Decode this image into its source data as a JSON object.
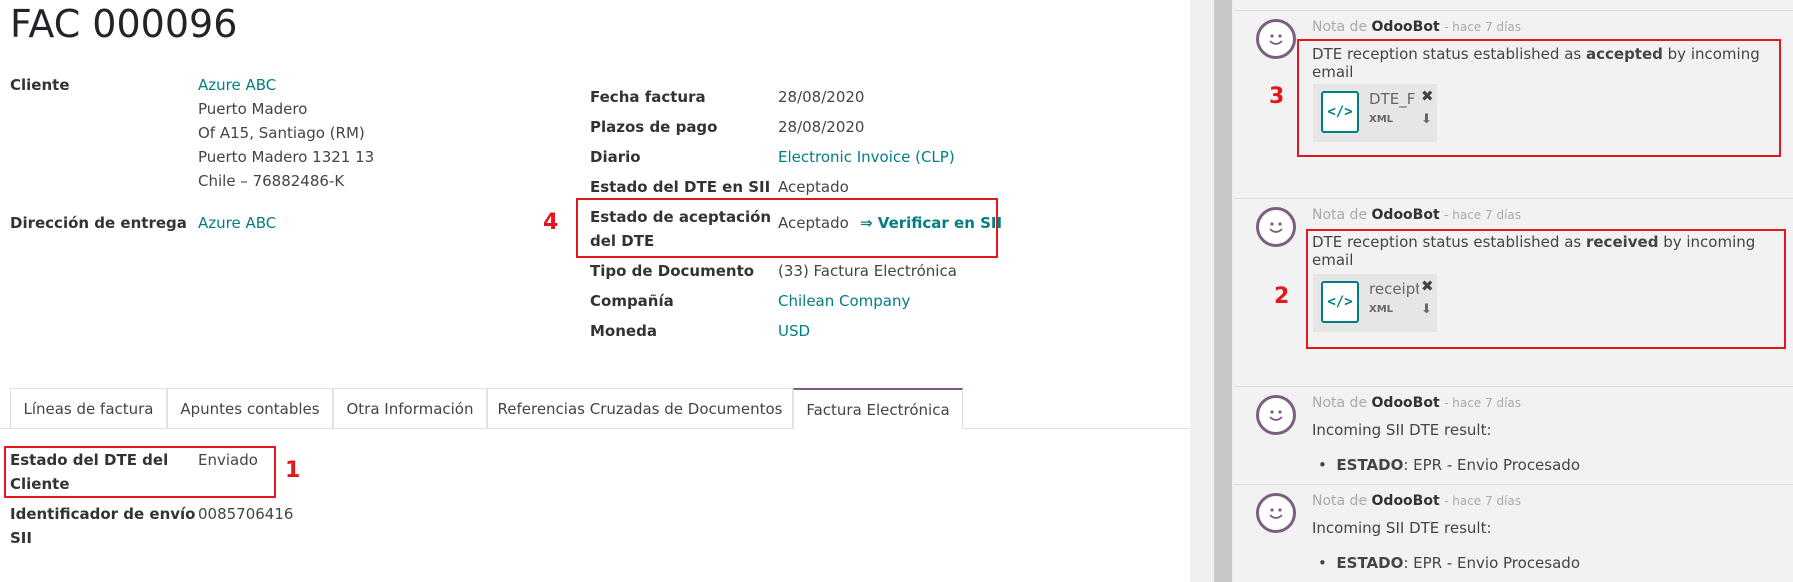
{
  "form": {
    "title": "FAC 000096",
    "left_fields": {
      "cliente_label": "Cliente",
      "cliente_name": "Azure ABC",
      "address_lines": [
        "Puerto Madero",
        "Of A15, Santiago (RM)",
        "Puerto Madero 1321 13",
        "Chile – 76882486-K"
      ],
      "entrega_label": "Dirección de entrega",
      "entrega_value": "Azure ABC"
    },
    "right_fields": {
      "fecha_label": "Fecha factura",
      "fecha_value": "28/08/2020",
      "plazos_label": "Plazos de pago",
      "plazos_value": "28/08/2020",
      "diario_label": "Diario",
      "diario_value": "Electronic Invoice (CLP)",
      "estado_sii_label": "Estado del DTE en SII",
      "estado_sii_value": "Aceptado",
      "aceptacion_label_line1": "Estado de aceptación",
      "aceptacion_label_line2": "del DTE",
      "aceptacion_value": "Aceptado",
      "verificar_link": "⇒ Verificar en SII",
      "tipo_label": "Tipo de Documento",
      "tipo_value": "(33) Factura Electrónica",
      "compania_label": "Compañía",
      "compania_value": "Chilean Company",
      "moneda_label": "Moneda",
      "moneda_value": "USD"
    },
    "tabs": [
      "Líneas de factura",
      "Apuntes contables",
      "Otra Información",
      "Referencias Cruzadas de Documentos",
      "Factura Electrónica"
    ],
    "active_tab": "Factura Electrónica",
    "tab_fields": {
      "estado_cliente_label_line1": "Estado del DTE del",
      "estado_cliente_label_line2": "Cliente",
      "estado_cliente_value": "Enviado",
      "identificador_label_line1": "Identificador de envío",
      "identificador_label_line2": "SII",
      "identificador_value": "0085706416"
    }
  },
  "annotations": [
    "1",
    "2",
    "3",
    "4"
  ],
  "annotation_color": "#e2181f",
  "chatter": {
    "messages": [
      {
        "prefix": "Nota de",
        "author": "OdooBot",
        "ago": "- hace 7 días",
        "body_before": "DTE reception status established as ",
        "body_bold": "accepted",
        "body_after": " by incoming email",
        "attachment": {
          "name": "DTE_F",
          "type": "XML"
        }
      },
      {
        "prefix": "Nota de",
        "author": "OdooBot",
        "ago": "- hace 7 días",
        "body_before": "DTE reception status established as ",
        "body_bold": "received",
        "body_after": " by incoming email",
        "attachment": {
          "name": "receipt",
          "type": "XML"
        }
      },
      {
        "prefix": "Nota de",
        "author": "OdooBot",
        "ago": "- hace 7 días",
        "body": "Incoming SII DTE result:",
        "bullet_label": "ESTADO",
        "bullet_value": ": EPR - Envio Procesado"
      },
      {
        "prefix": "Nota de",
        "author": "OdooBot",
        "ago": "- hace 7 días",
        "body": "Incoming SII DTE result:",
        "bullet_label": "ESTADO",
        "bullet_value": ": EPR - Envio Procesado"
      }
    ]
  },
  "colors": {
    "link": "#017e84",
    "accent": "#7c5f80",
    "annotation": "#e2181f"
  },
  "icons": {
    "avatar": "smiley-icon",
    "file": "xml-file-icon",
    "remove": "close-icon",
    "download": "download-icon"
  }
}
